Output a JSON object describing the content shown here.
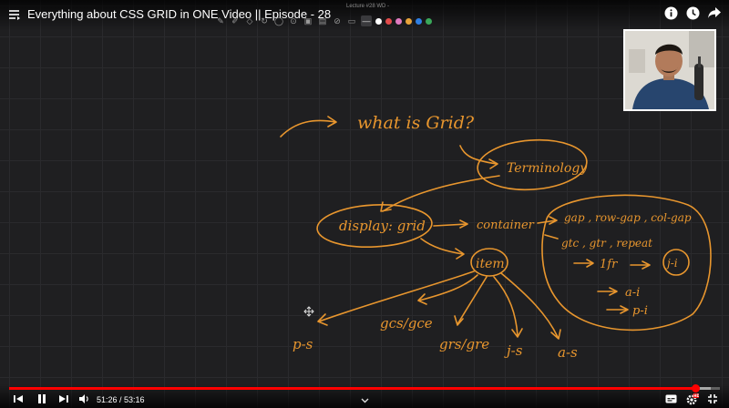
{
  "header": {
    "title": "Everything about CSS GRID in ONE Video || Episode - 28",
    "lecture_label": "Lecture #28 WD -"
  },
  "toolbar": {
    "tools": [
      "pen-icon",
      "highlighter-icon",
      "eraser-icon",
      "lasso-icon",
      "shapes-icon",
      "undo-icon",
      "image-icon",
      "text-icon",
      "link-icon",
      "clear-icon",
      "line-width-icon"
    ],
    "colors": [
      "#ffffff",
      "#e24b4b",
      "#e07ac1",
      "#e8a33a",
      "#2f7fe3",
      "#3aa85a"
    ]
  },
  "board": {
    "heading": "what is Grid?",
    "nodes": {
      "terminology": "Terminology",
      "display_grid": "display: grid",
      "container": "container",
      "item": "item",
      "gap": "gap , row-gap , col-gap",
      "gtc": "gtc , gtr , repeat",
      "fr": "1fr",
      "j": "j-i",
      "ai": "a-i",
      "pi": "p-i",
      "ps": "p-s",
      "gcs": "gcs/gce",
      "grs": "grs/gre",
      "js": "j-s",
      "as": "a-s"
    }
  },
  "player": {
    "current_time": "51:26",
    "duration": "53:16",
    "time_display": "51:26 / 53:16",
    "progress": 0.9656,
    "buffered": 0.9875,
    "hd_badge": "HD",
    "accent": "#ff0000"
  },
  "colors": {
    "ink": "#e8962e",
    "background": "#1f1f21"
  }
}
